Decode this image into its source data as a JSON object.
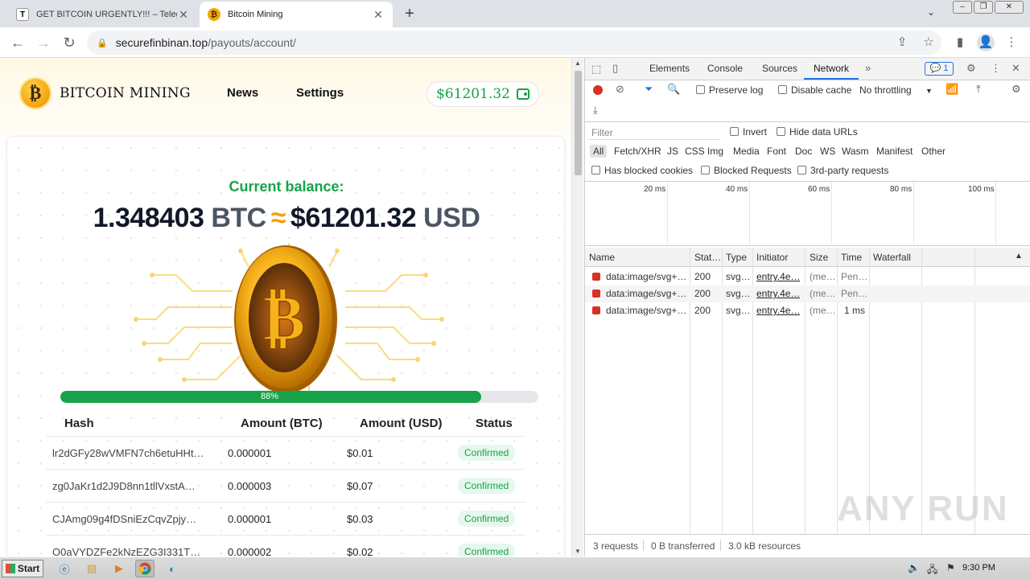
{
  "browser": {
    "tabs": [
      {
        "favicon": "T",
        "title": "GET BITCOIN URGENTLY!!! – Telegra"
      },
      {
        "favicon": "₿",
        "title": "Bitcoin Mining"
      }
    ],
    "url_host": "securefinbinan.top",
    "url_path": "/payouts/account/"
  },
  "site": {
    "logo_symbol": "₿",
    "logo_text": "BITCOIN MINING",
    "nav": [
      "News",
      "Settings"
    ],
    "wallet_balance": "$61201.32",
    "balance_label": "Current balance:",
    "balance_btc": "1.348403",
    "btc_unit": "BTC",
    "approx": "≈",
    "balance_usd": "$61201.32",
    "usd_unit": "USD",
    "progress": {
      "value": 0.88,
      "label": "88%"
    },
    "table": {
      "headers": [
        "Hash",
        "Amount (BTC)",
        "Amount (USD)",
        "Status"
      ],
      "rows": [
        {
          "hash": "lr2dGFy28wVMFN7ch6etuHHt…",
          "btc": "0.000001",
          "usd": "$0.01",
          "status": "Confirmed"
        },
        {
          "hash": "zg0JaKr1d2J9D8nn1tllVxstA…",
          "btc": "0.000003",
          "usd": "$0.07",
          "status": "Confirmed"
        },
        {
          "hash": "CJAmg09g4fDSniEzCqvZpjy…",
          "btc": "0.000001",
          "usd": "$0.03",
          "status": "Confirmed"
        },
        {
          "hash": "O0aVYDZFe2kNzEZG3I331T…",
          "btc": "0.000002",
          "usd": "$0.02",
          "status": "Confirmed"
        }
      ]
    },
    "colors": {
      "accent_green": "#16a34a",
      "accent_orange": "#f59e0b"
    }
  },
  "devtools": {
    "tabs": [
      "Elements",
      "Console",
      "Sources",
      "Network"
    ],
    "active_tab": "Network",
    "issues_count": "1",
    "preserve_log": "Preserve log",
    "disable_cache": "Disable cache",
    "throttling": "No throttling",
    "filter_placeholder": "Filter",
    "invert": "Invert",
    "hide_data_urls": "Hide data URLs",
    "types": [
      "All",
      "Fetch/XHR",
      "JS",
      "CSS",
      "Img",
      "Media",
      "Font",
      "Doc",
      "WS",
      "Wasm",
      "Manifest",
      "Other"
    ],
    "has_blocked_cookies": "Has blocked cookies",
    "blocked_requests": "Blocked Requests",
    "third_party": "3rd-party requests",
    "timeline_ticks": [
      "20 ms",
      "40 ms",
      "60 ms",
      "80 ms",
      "100 ms"
    ],
    "columns": [
      "Name",
      "Stat…",
      "Type",
      "Initiator",
      "Size",
      "Time",
      "Waterfall"
    ],
    "requests": [
      {
        "name": "data:image/svg+…",
        "status": "200",
        "type": "svg…",
        "initiator": "entry.4e…",
        "size": "(me…",
        "time": "Pen…"
      },
      {
        "name": "data:image/svg+…",
        "status": "200",
        "type": "svg…",
        "initiator": "entry.4e…",
        "size": "(me…",
        "time": "Pen…"
      },
      {
        "name": "data:image/svg+…",
        "status": "200",
        "type": "svg…",
        "initiator": "entry.4e…",
        "size": "(me…",
        "time": "1 ms"
      }
    ],
    "status_bar": [
      "3 requests",
      "0 B transferred",
      "3.0 kB resources"
    ]
  },
  "watermark": "ANY RUN",
  "taskbar": {
    "start": "Start",
    "clock": "9:30 PM"
  }
}
